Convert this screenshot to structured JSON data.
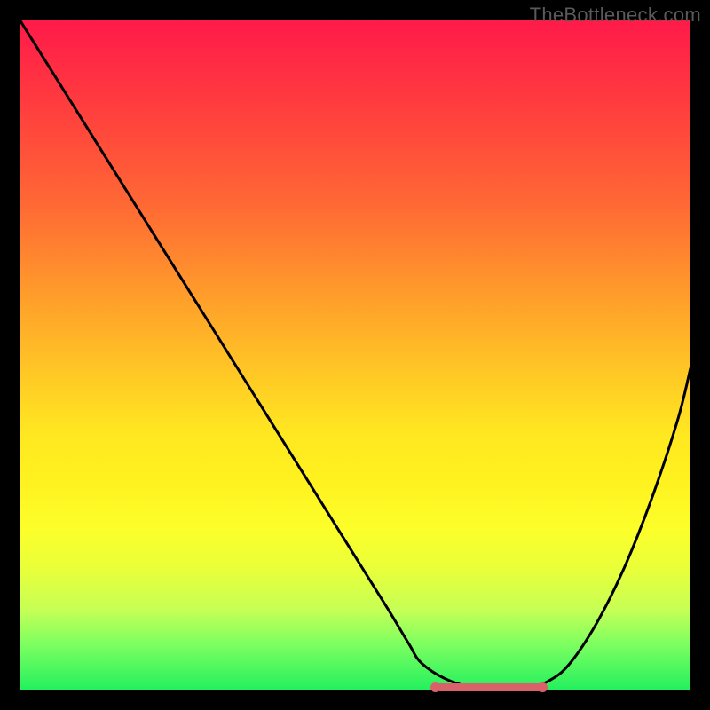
{
  "watermark": "TheBottleneck.com",
  "colors": {
    "background": "#000000",
    "curve": "#000000",
    "flat_segment": "#d9626a",
    "gradient_top": "#ff1a4a",
    "gradient_bottom": "#22f05e"
  },
  "chart_data": {
    "type": "line",
    "title": "",
    "xlabel": "",
    "ylabel": "",
    "xlim": [
      0,
      100
    ],
    "ylim": [
      0,
      100
    ],
    "annotations": [
      "TheBottleneck.com"
    ],
    "series": [
      {
        "name": "curve",
        "x": [
          0,
          5,
          10,
          15,
          20,
          25,
          30,
          35,
          40,
          45,
          50,
          55,
          58,
          60,
          64,
          68,
          72,
          76,
          79,
          82,
          86,
          90,
          94,
          98,
          100
        ],
        "y": [
          100,
          92,
          84,
          76,
          68,
          60,
          52,
          44,
          36,
          28,
          20,
          12,
          7,
          4,
          1.5,
          0.5,
          0.5,
          0.5,
          1.5,
          4,
          10,
          18,
          28,
          40,
          48
        ]
      }
    ],
    "flat_segment": {
      "x_start": 62,
      "x_end": 78,
      "y": 0.5
    }
  }
}
